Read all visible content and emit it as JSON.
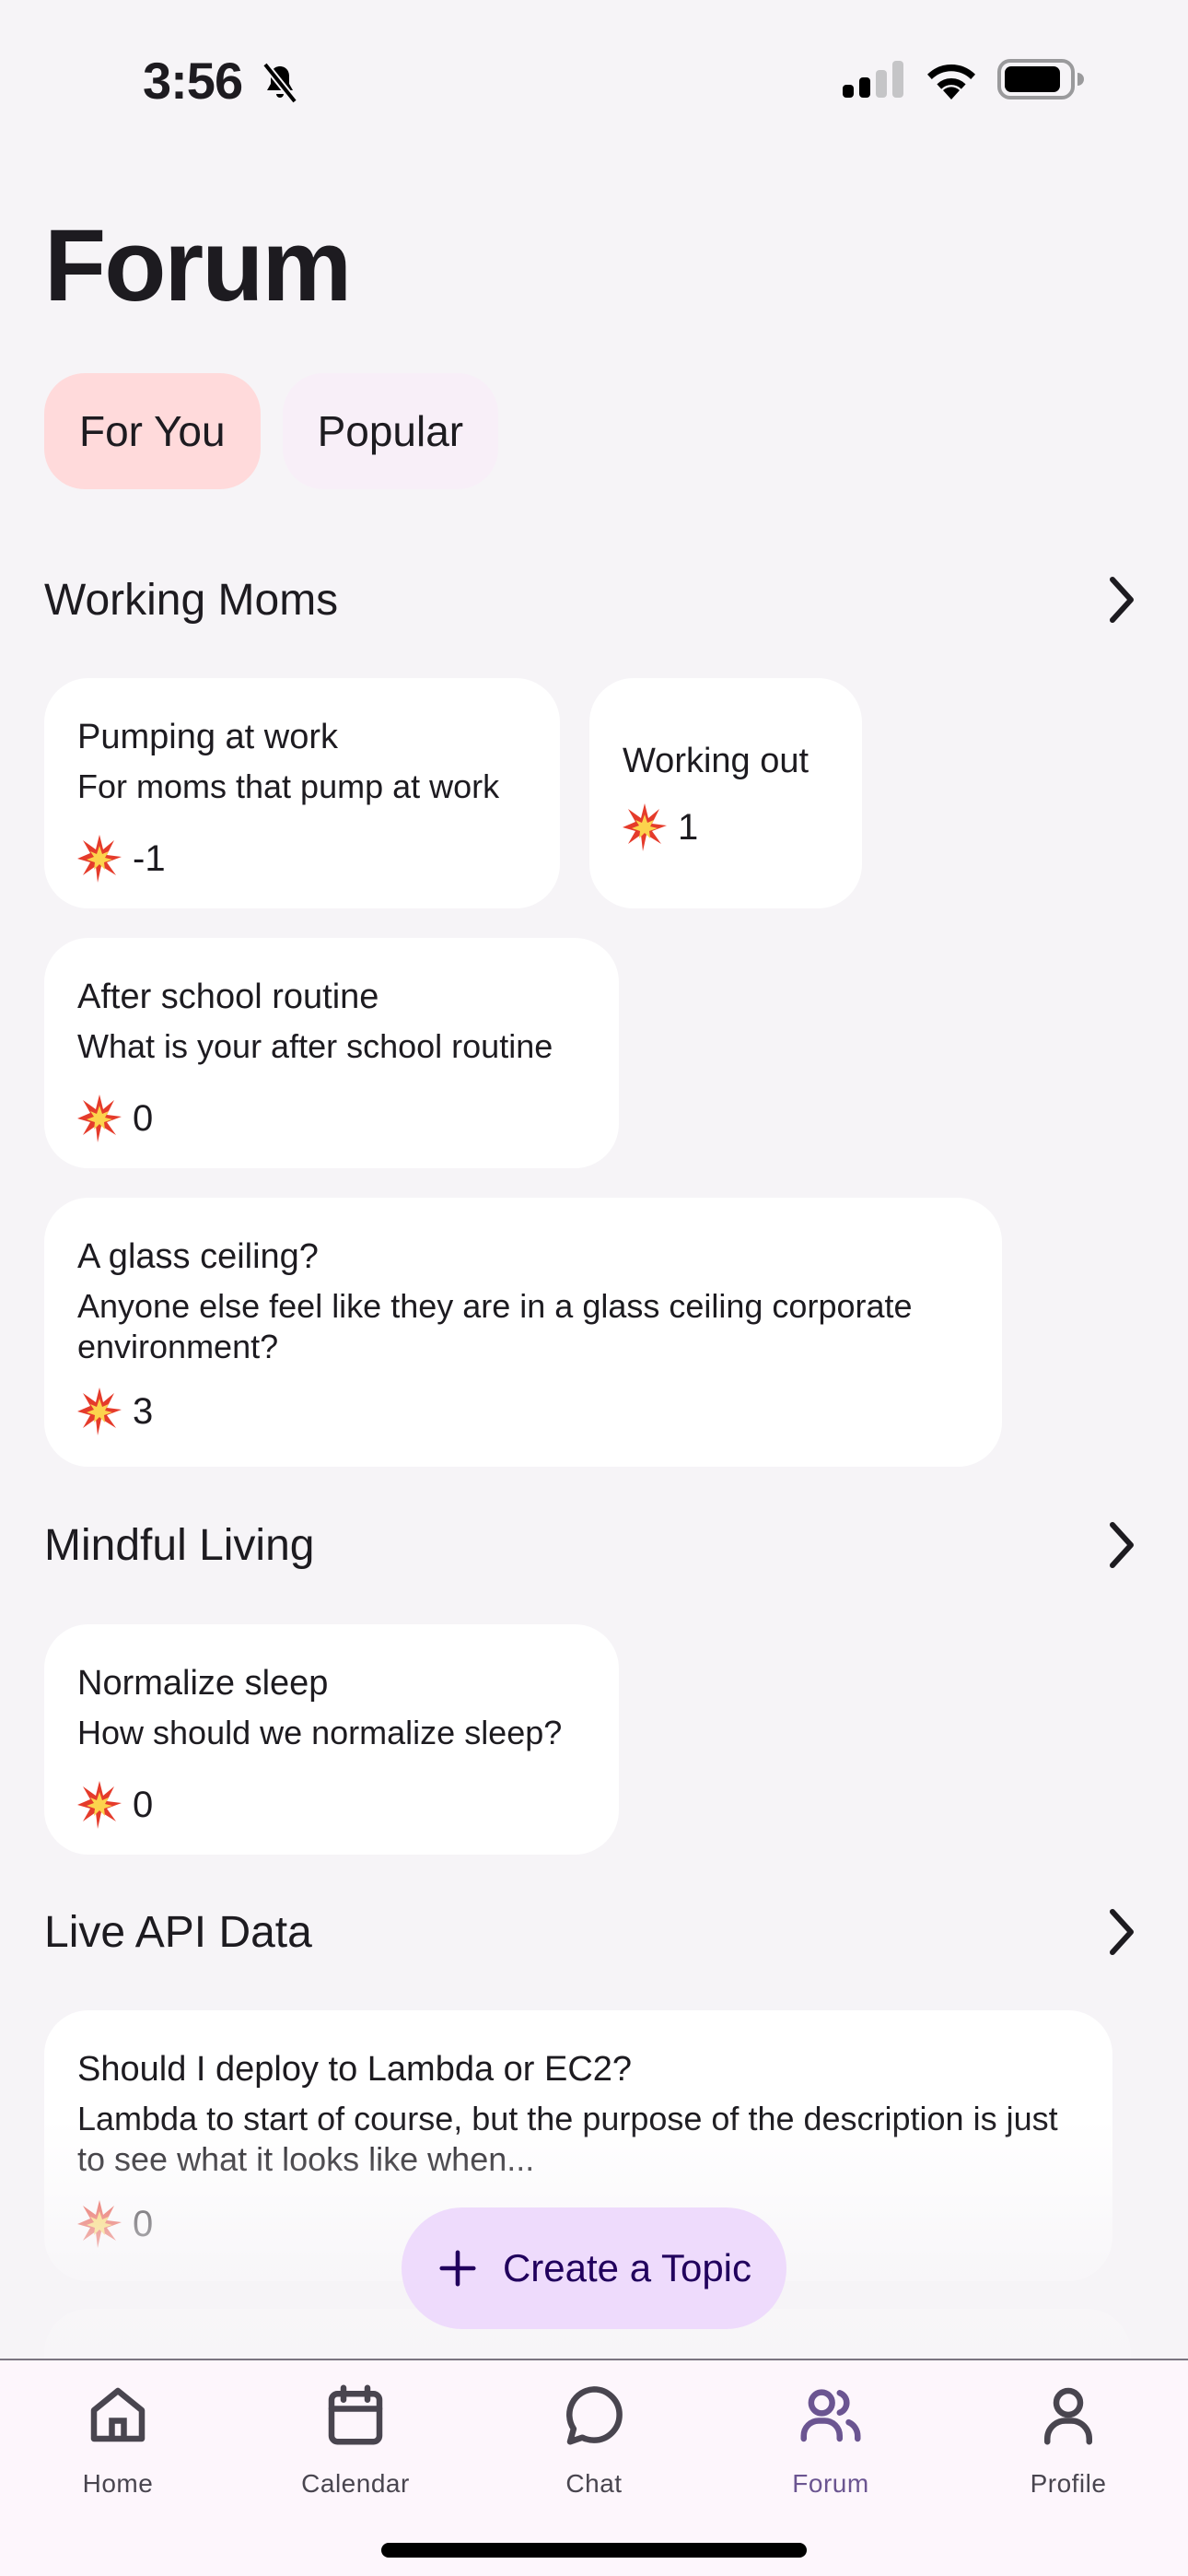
{
  "status_bar": {
    "time": "3:56",
    "icons": [
      "bell-slash-icon",
      "cellular-signal-icon",
      "wifi-icon",
      "battery-icon"
    ]
  },
  "header": {
    "title": "Forum"
  },
  "filter_tabs": [
    {
      "label": "For You",
      "active": true
    },
    {
      "label": "Popular",
      "active": false
    }
  ],
  "sections": [
    {
      "title": "Working Moms",
      "topics": [
        {
          "title": "Pumping at work",
          "description": "For moms that pump at work",
          "score": "-1"
        },
        {
          "title": "Working out",
          "description": "",
          "score": "1"
        },
        {
          "title": "After school routine",
          "description": "What is your after school routine",
          "score": "0"
        },
        {
          "title": "A glass ceiling?",
          "description": "Anyone else feel like they are in a glass ceiling corporate environment?",
          "score": "3"
        }
      ]
    },
    {
      "title": "Mindful Living",
      "topics": [
        {
          "title": "Normalize sleep",
          "description": "How should we normalize sleep?",
          "score": "0"
        }
      ]
    },
    {
      "title": "Live API Data",
      "topics": [
        {
          "title": "Should I deploy to Lambda or EC2?",
          "description": "Lambda to start of course, but the purpose of the description is just to see what it looks like when...",
          "score": "0"
        }
      ]
    }
  ],
  "score_icon": "collision-emoji-icon",
  "fab": {
    "label": "Create a Topic",
    "icon": "plus-icon"
  },
  "bottom_nav": [
    {
      "label": "Home",
      "icon": "home-icon",
      "active": false
    },
    {
      "label": "Calendar",
      "icon": "calendar-icon",
      "active": false
    },
    {
      "label": "Chat",
      "icon": "chat-bubble-icon",
      "active": false
    },
    {
      "label": "Forum",
      "icon": "people-icon",
      "active": true
    },
    {
      "label": "Profile",
      "icon": "person-icon",
      "active": false
    }
  ],
  "colors": {
    "background": "#f6f4f7",
    "tab_active_bg": "#ffdadb",
    "tab_inactive_bg": "#f8eff8",
    "fab_bg": "#eedbfc",
    "nav_active": "#6b5591",
    "nav_inactive": "#49454f"
  }
}
